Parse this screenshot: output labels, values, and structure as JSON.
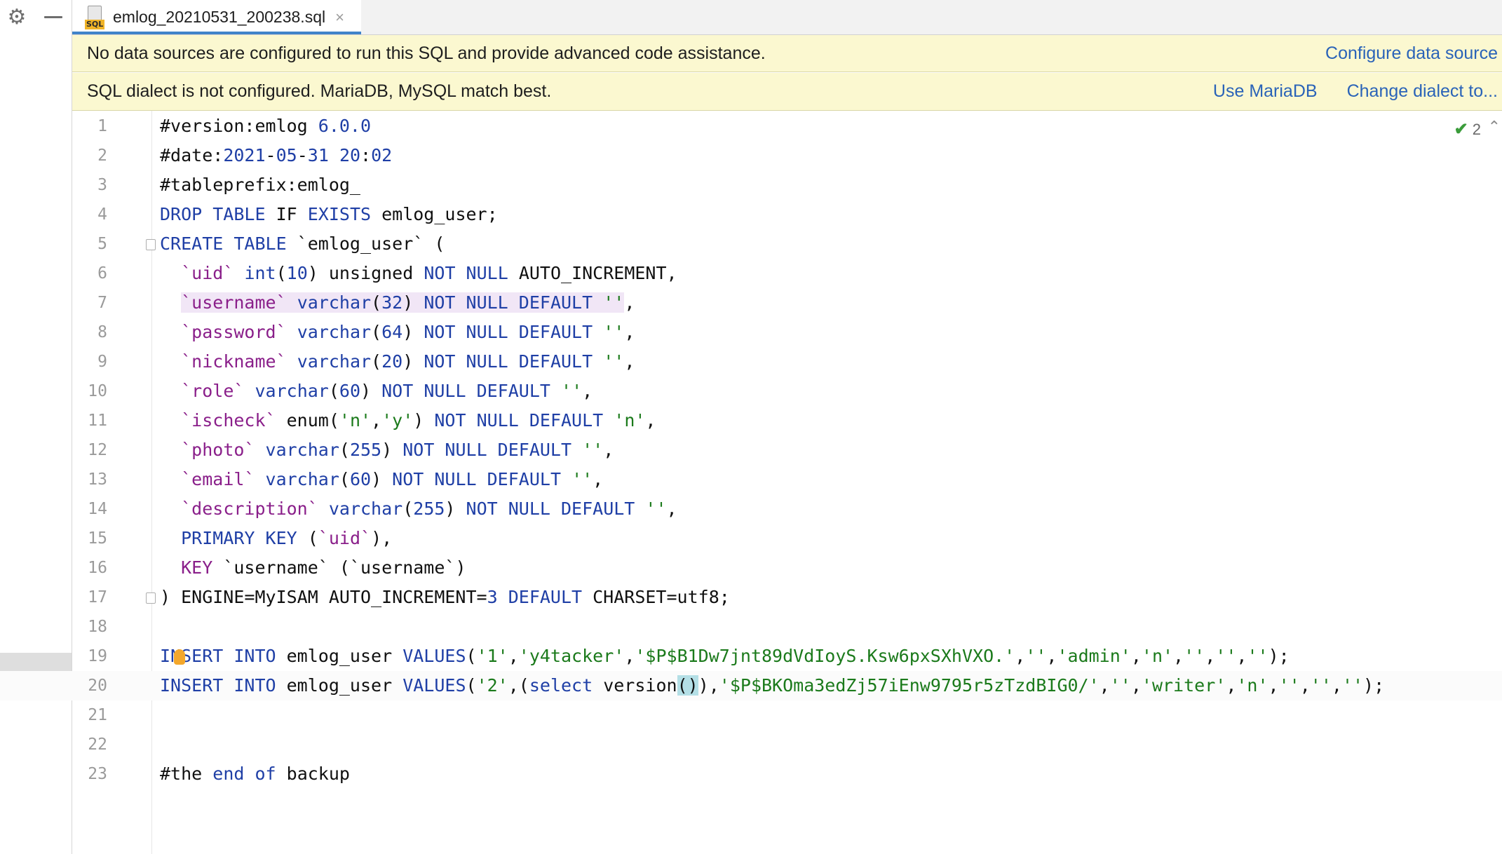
{
  "tab": {
    "file_name": "emlog_20210531_200238.sql",
    "close_glyph": "×",
    "file_badge": "SQL"
  },
  "banners": {
    "no_datasource": {
      "text": "No data sources are configured to run this SQL and provide advanced code assistance.",
      "link": "Configure data source"
    },
    "dialect": {
      "text": "SQL dialect is not configured. MariaDB, MySQL match best.",
      "link1": "Use MariaDB",
      "link2": "Change dialect to..."
    }
  },
  "inspection": {
    "count": "2"
  },
  "lines": [
    "1",
    "2",
    "3",
    "4",
    "5",
    "6",
    "7",
    "8",
    "9",
    "10",
    "11",
    "12",
    "13",
    "14",
    "15",
    "16",
    "17",
    "18",
    "19",
    "20",
    "21",
    "22",
    "23"
  ],
  "code": {
    "l1": [
      "#version:emlog ",
      "6.0.0"
    ],
    "l2": [
      "#date:",
      "2021",
      "-",
      "05",
      "-",
      "31",
      " ",
      "20",
      ":",
      "02"
    ],
    "l3": [
      "#tableprefix:emlog_"
    ],
    "l4": [
      "DROP TABLE",
      " IF ",
      "EXISTS",
      " emlog_user;"
    ],
    "l5": [
      "CREATE TABLE",
      " `emlog_user` ("
    ],
    "l6": [
      "  ",
      "`uid`",
      " ",
      "int",
      "(",
      "10",
      ") unsigned ",
      "NOT NULL",
      " AUTO_INCREMENT,"
    ],
    "l7": [
      "  ",
      "`username`",
      " ",
      "varchar",
      "(",
      "32",
      ") ",
      "NOT NULL DEFAULT",
      " ",
      "''",
      ","
    ],
    "l8": [
      "  ",
      "`password`",
      " ",
      "varchar",
      "(",
      "64",
      ") ",
      "NOT NULL DEFAULT",
      " ",
      "''",
      ","
    ],
    "l9": [
      "  ",
      "`nickname`",
      " ",
      "varchar",
      "(",
      "20",
      ") ",
      "NOT NULL DEFAULT",
      " ",
      "''",
      ","
    ],
    "l10": [
      "  ",
      "`role`",
      " ",
      "varchar",
      "(",
      "60",
      ") ",
      "NOT NULL DEFAULT",
      " ",
      "''",
      ","
    ],
    "l11": [
      "  ",
      "`ischeck`",
      " enum(",
      "'n'",
      ",",
      "'y'",
      ") ",
      "NOT NULL DEFAULT",
      " ",
      "'n'",
      ","
    ],
    "l12": [
      "  ",
      "`photo`",
      " ",
      "varchar",
      "(",
      "255",
      ") ",
      "NOT NULL DEFAULT",
      " ",
      "''",
      ","
    ],
    "l13": [
      "  ",
      "`email`",
      " ",
      "varchar",
      "(",
      "60",
      ") ",
      "NOT NULL DEFAULT",
      " ",
      "''",
      ","
    ],
    "l14": [
      "  ",
      "`description`",
      " ",
      "varchar",
      "(",
      "255",
      ") ",
      "NOT NULL DEFAULT",
      " ",
      "''",
      ","
    ],
    "l15": [
      "  ",
      "PRIMARY KEY",
      " (",
      "`uid`",
      "),"
    ],
    "l16": [
      "  ",
      "KEY",
      " `username` (`username`)"
    ],
    "l17": [
      ") ENGINE=MyISAM AUTO_INCREMENT=",
      "3",
      " ",
      "DEFAULT",
      " CHARSET=utf8;"
    ],
    "l19": [
      "INSERT INTO",
      " emlog_user ",
      "VALUES",
      "(",
      "'1'",
      ",",
      "'y4tacker'",
      ",",
      "'$P$B1Dw7jnt89dVdIoyS.Ksw6pxSXhVXO.'",
      ",",
      "''",
      ",",
      "'admin'",
      ",",
      "'n'",
      ",",
      "''",
      ",",
      "''",
      ",",
      "''",
      ");"
    ],
    "l20": [
      "INSERT INTO",
      " emlog_user ",
      "VALUES",
      "(",
      "'2'",
      ",(",
      "select",
      " version",
      "()",
      "),",
      "'$P$BKOma3edZj57iEnw9795r5zTzdBIG0/'",
      ",",
      "''",
      ",",
      "'writer'",
      ",",
      "'n'",
      ",",
      "''",
      ",",
      "''",
      ",",
      "''",
      ");"
    ],
    "l23": [
      "#the ",
      "end",
      " ",
      "of",
      " backup"
    ]
  }
}
